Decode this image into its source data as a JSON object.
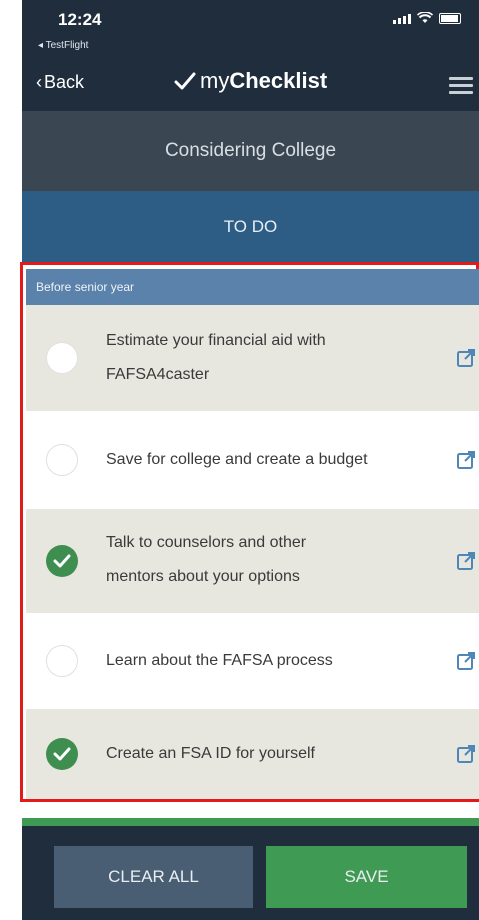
{
  "status_bar": {
    "time": "12:24",
    "back_app": "◂ TestFlight"
  },
  "nav": {
    "back_label": "Back",
    "title_regular": "my",
    "title_bold": "Checklist"
  },
  "section": {
    "title": "Considering College",
    "tab_label": "TO DO"
  },
  "group": {
    "header": "Before senior year",
    "items": [
      {
        "line1": "Estimate your financial aid with",
        "line2": "FAFSA4caster",
        "checked": false
      },
      {
        "line1": "Save for college and create a budget",
        "line2": "",
        "checked": false
      },
      {
        "line1": "Talk to counselors and other",
        "line2": "mentors about your options",
        "checked": true
      },
      {
        "line1": "Learn about the FAFSA process",
        "line2": "",
        "checked": false
      },
      {
        "line1": "Create an FSA ID for yourself",
        "line2": "",
        "checked": true
      }
    ]
  },
  "actions": {
    "clear_label": "CLEAR ALL",
    "save_label": "SAVE"
  },
  "colors": {
    "nav_bg": "#1f2d3d",
    "section_bg": "#3a4752",
    "tab_bg": "#2d5d84",
    "group_header_bg": "#5a82aa",
    "checked_green": "#3e8e4f",
    "highlight_red": "#e21a1a",
    "save_green": "#3f9a53",
    "clear_bg": "#4a5e73"
  }
}
